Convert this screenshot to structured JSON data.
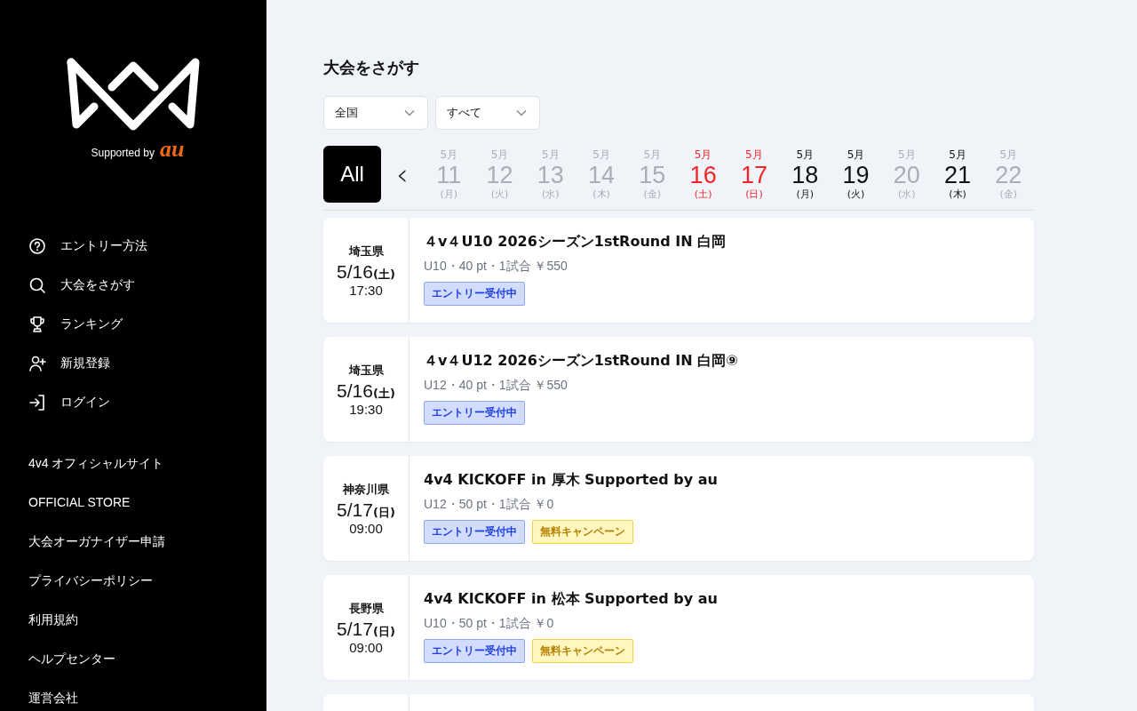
{
  "sidebar": {
    "logo": {
      "supported_by": "Supported by",
      "sponsor": "au"
    },
    "nav": [
      {
        "label": "エントリー方法"
      },
      {
        "label": "大会をさがす"
      },
      {
        "label": "ランキング"
      },
      {
        "label": "新規登録"
      },
      {
        "label": "ログイン"
      }
    ],
    "links": [
      "4v4 オフィシャルサイト",
      "OFFICIAL STORE",
      "大会オーガナイザー申請",
      "プライバシーポリシー",
      "利用規約",
      "ヘルプセンター",
      "運営会社"
    ]
  },
  "main": {
    "title": "大会をさがす",
    "filters": [
      {
        "value": "全国"
      },
      {
        "value": "すべて"
      }
    ],
    "all_button": {
      "label": "All",
      "selected": true
    },
    "prev": "‹",
    "dates": [
      {
        "month": "5月",
        "day": "11",
        "weekday": "(月)",
        "kind": "empty"
      },
      {
        "month": "5月",
        "day": "12",
        "weekday": "(火)",
        "kind": "empty"
      },
      {
        "month": "5月",
        "day": "13",
        "weekday": "(水)",
        "kind": "empty"
      },
      {
        "month": "5月",
        "day": "14",
        "weekday": "(木)",
        "kind": "empty"
      },
      {
        "month": "5月",
        "day": "15",
        "weekday": "(金)",
        "kind": "empty"
      },
      {
        "month": "5月",
        "day": "16",
        "weekday": "(土)",
        "kind": "holiday"
      },
      {
        "month": "5月",
        "day": "17",
        "weekday": "(日)",
        "kind": "holiday"
      },
      {
        "month": "5月",
        "day": "18",
        "weekday": "(月)",
        "kind": "normal"
      },
      {
        "month": "5月",
        "day": "19",
        "weekday": "(火)",
        "kind": "normal"
      },
      {
        "month": "5月",
        "day": "20",
        "weekday": "(水)",
        "kind": "empty"
      },
      {
        "month": "5月",
        "day": "21",
        "weekday": "(木)",
        "kind": "normal"
      },
      {
        "month": "5月",
        "day": "22",
        "weekday": "(金)",
        "kind": "empty"
      }
    ],
    "events": [
      {
        "kind": "full",
        "prefecture": "埼玉県",
        "date": "5/16",
        "weekday": "(土)",
        "time": "17:30",
        "title": "４v４U10 2026シーズン1stRound IN 白岡",
        "details": "U10・40 pt・1試合 ￥550",
        "tags": [
          {
            "label": "エントリー受付中",
            "kind": "entry"
          }
        ]
      },
      {
        "kind": "full",
        "prefecture": "埼玉県",
        "date": "5/16",
        "weekday": "(土)",
        "time": "19:30",
        "title": "４v４U12 2026シーズン1stRound IN 白岡⑨",
        "details": "U12・40 pt・1試合 ￥550",
        "tags": [
          {
            "label": "エントリー受付中",
            "kind": "entry"
          }
        ]
      },
      {
        "kind": "full",
        "prefecture": "神奈川県",
        "date": "5/17",
        "weekday": "(日)",
        "time": "09:00",
        "title": "4v4 KICKOFF in 厚木 Supported by au",
        "details": "U12・50 pt・1試合 ￥0",
        "tags": [
          {
            "label": "エントリー受付中",
            "kind": "entry"
          },
          {
            "label": "無料キャンペーン",
            "kind": "campaign"
          }
        ]
      },
      {
        "kind": "full",
        "prefecture": "長野県",
        "date": "5/17",
        "weekday": "(日)",
        "time": "09:00",
        "title": "4v4 KICKOFF in 松本 Supported by au",
        "details": "U10・50 pt・1試合 ￥0",
        "tags": [
          {
            "label": "エントリー受付中",
            "kind": "entry"
          },
          {
            "label": "無料キャンペーン",
            "kind": "campaign"
          }
        ]
      },
      {
        "kind": "clipped"
      }
    ]
  }
}
